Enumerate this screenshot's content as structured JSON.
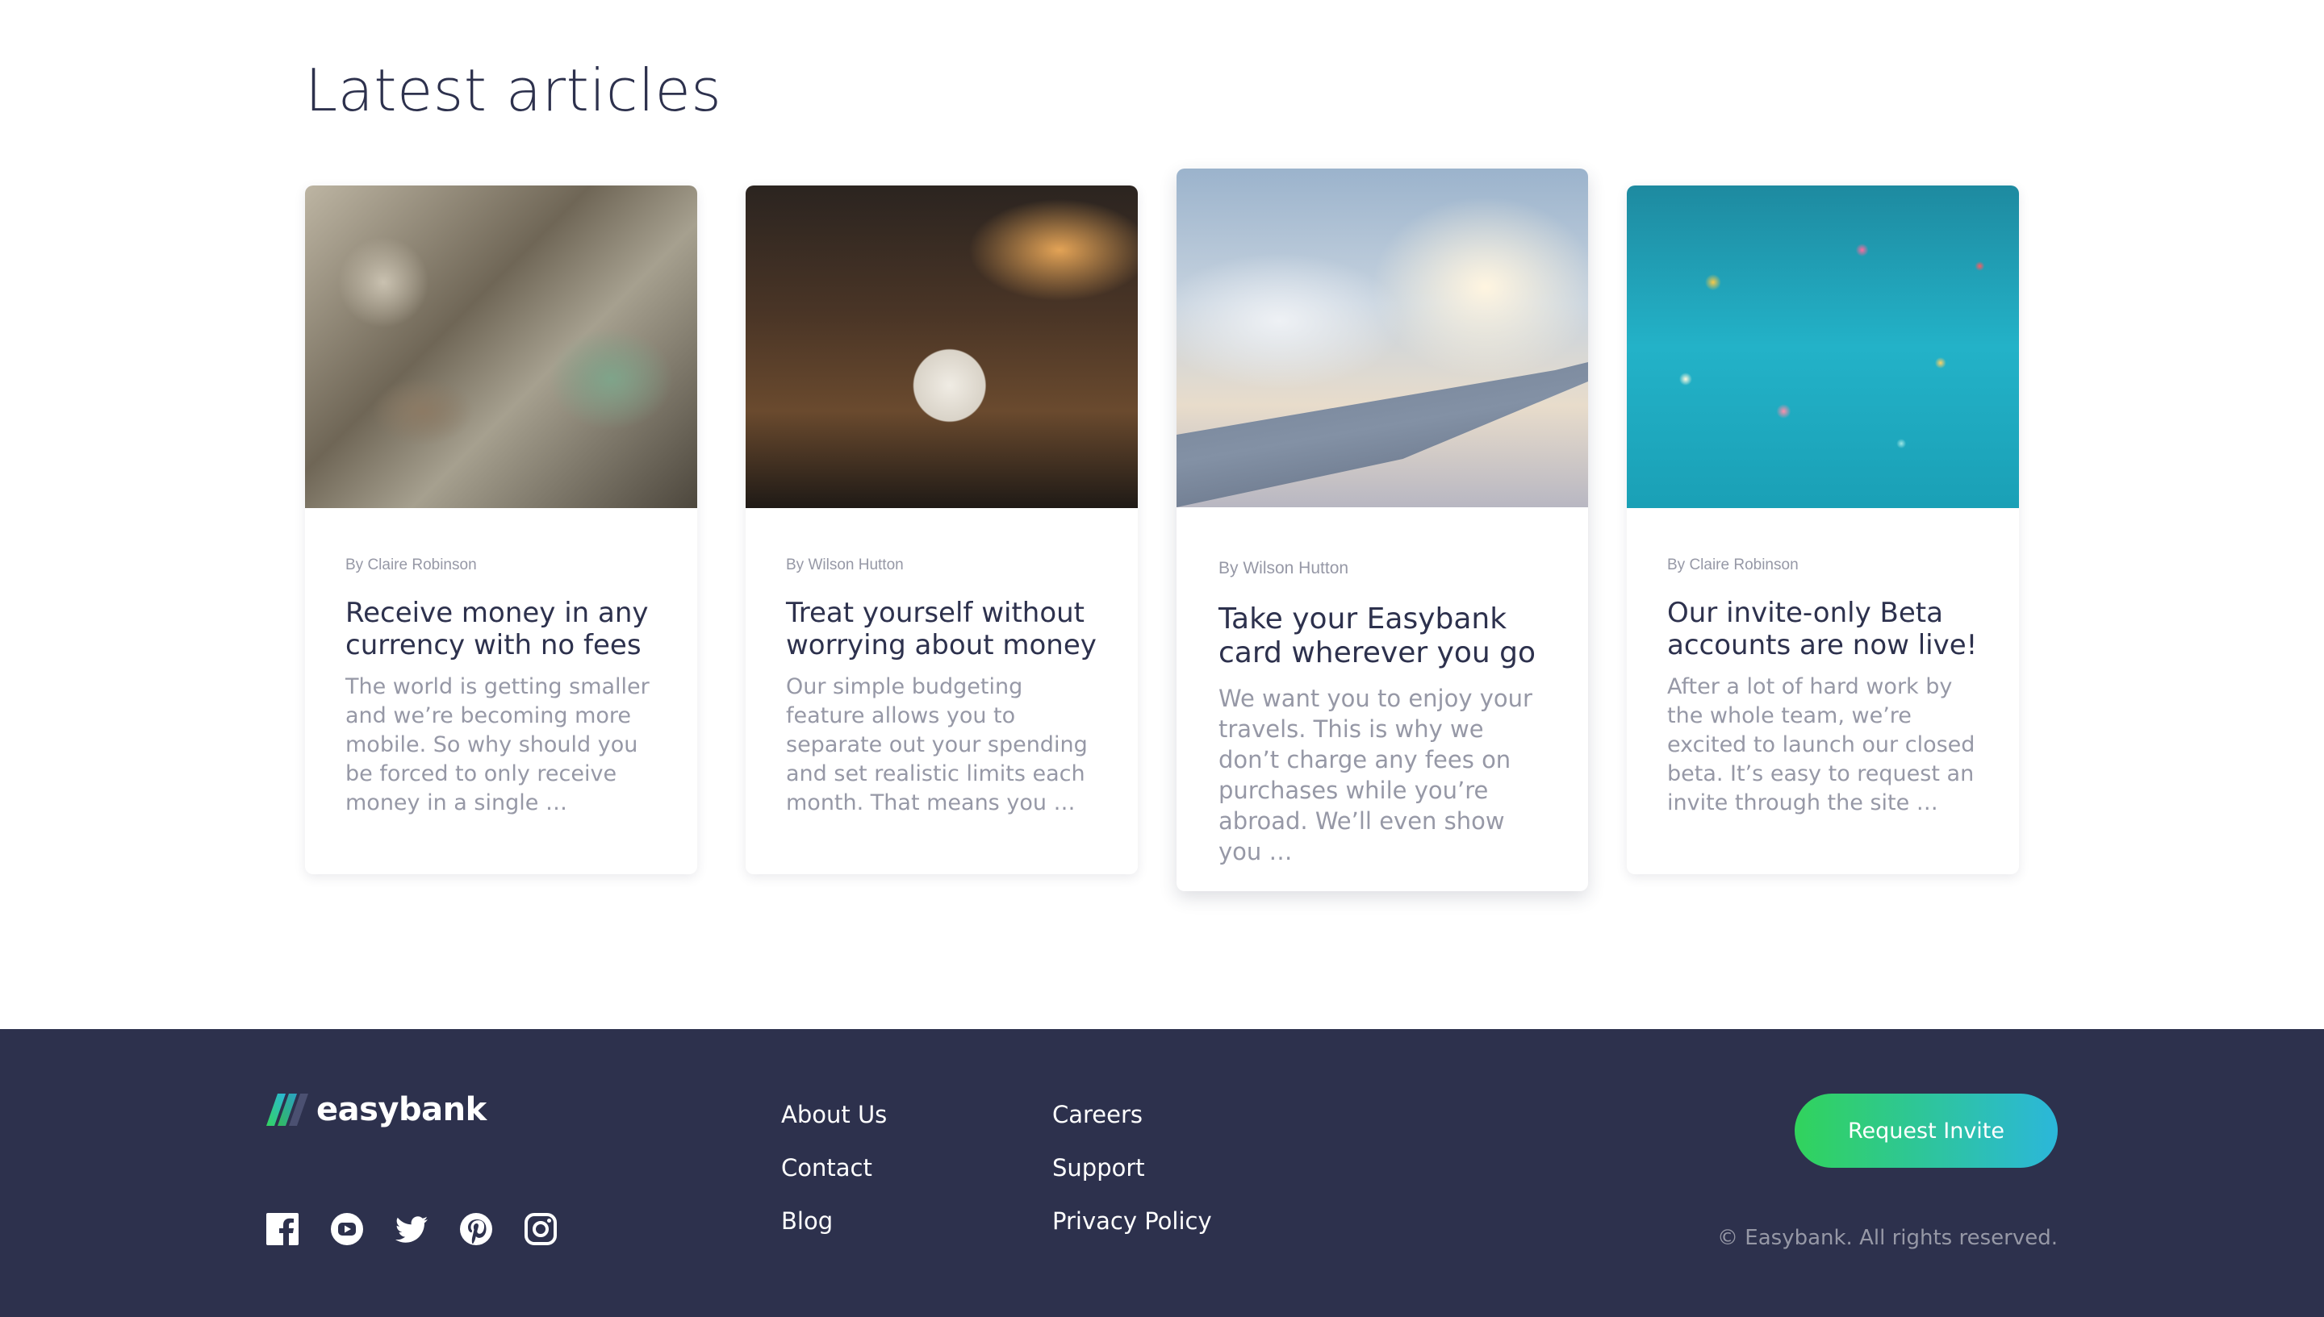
{
  "section": {
    "title": "Latest articles"
  },
  "articles": [
    {
      "author": "By Claire Robinson",
      "title": "Receive money in any currency with no fees",
      "excerpt": "The world is getting smaller and we’re becoming more mobile. So why should you be forced to only receive money in a single …",
      "image": "banknotes-photo"
    },
    {
      "author": "By Wilson Hutton",
      "title": "Treat yourself without worrying about money",
      "excerpt": "Our simple budgeting feature allows you to separate out your spending and set realistic limits each month. That means you …",
      "image": "restaurant-plate-photo"
    },
    {
      "author": "By Wilson Hutton",
      "title": "Take your Easybank card wherever you go",
      "excerpt": "We want you to enjoy your travels. This is why we don’t charge any fees on purchases while you’re abroad. We’ll even show you …",
      "image": "airplane-wing-photo"
    },
    {
      "author": "By Claire Robinson",
      "title": "Our invite-only Beta accounts are now live!",
      "excerpt": "After a lot of hard work by the whole team, we’re excited to launch our closed beta. It’s easy to request an invite through the site …",
      "image": "confetti-photo"
    }
  ],
  "footer": {
    "logo_text": "easybank",
    "socials": [
      "facebook-icon",
      "youtube-icon",
      "twitter-icon",
      "pinterest-icon",
      "instagram-icon"
    ],
    "links_col1": [
      "About Us",
      "Contact",
      "Blog"
    ],
    "links_col2": [
      "Careers",
      "Support",
      "Privacy Policy"
    ],
    "cta_label": "Request Invite",
    "copyright": "© Easybank. All rights reserved.",
    "colors": {
      "background": "#2d314d",
      "cta_start": "#31d35c",
      "cta_end": "#2bb7da",
      "muted_text": "#9698a6"
    }
  }
}
